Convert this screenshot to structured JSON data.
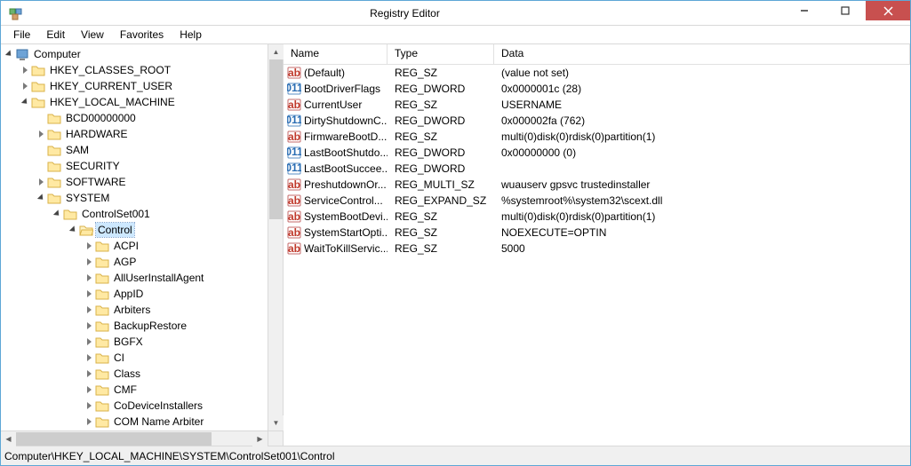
{
  "window": {
    "title": "Registry Editor"
  },
  "menu": {
    "file": "File",
    "edit": "Edit",
    "view": "View",
    "favorites": "Favorites",
    "help": "Help"
  },
  "tree": {
    "root": "Computer",
    "hives": {
      "hkcr": "HKEY_CLASSES_ROOT",
      "hkcu": "HKEY_CURRENT_USER",
      "hklm": "HKEY_LOCAL_MACHINE",
      "hklm_children": {
        "bcd": "BCD00000000",
        "hardware": "HARDWARE",
        "sam": "SAM",
        "security": "SECURITY",
        "software": "SOFTWARE",
        "system": "SYSTEM",
        "system_children": {
          "cs001": "ControlSet001",
          "cs001_children": {
            "control": "Control",
            "control_children": [
              "ACPI",
              "AGP",
              "AllUserInstallAgent",
              "AppID",
              "Arbiters",
              "BackupRestore",
              "BGFX",
              "CI",
              "Class",
              "CMF",
              "CoDeviceInstallers",
              "COM Name Arbiter"
            ]
          }
        }
      }
    }
  },
  "list": {
    "headers": {
      "name": "Name",
      "type": "Type",
      "data": "Data"
    },
    "rows": [
      {
        "icon": "sz",
        "name": "(Default)",
        "type": "REG_SZ",
        "data": "(value not set)"
      },
      {
        "icon": "dw",
        "name": "BootDriverFlags",
        "type": "REG_DWORD",
        "data": "0x0000001c (28)"
      },
      {
        "icon": "sz",
        "name": "CurrentUser",
        "type": "REG_SZ",
        "data": "USERNAME"
      },
      {
        "icon": "dw",
        "name": "DirtyShutdownC...",
        "type": "REG_DWORD",
        "data": "0x000002fa (762)"
      },
      {
        "icon": "sz",
        "name": "FirmwareBootD...",
        "type": "REG_SZ",
        "data": "multi(0)disk(0)rdisk(0)partition(1)"
      },
      {
        "icon": "dw",
        "name": "LastBootShutdo...",
        "type": "REG_DWORD",
        "data": "0x00000000 (0)"
      },
      {
        "icon": "dw",
        "name": "LastBootSuccee...",
        "type": "REG_DWORD",
        "data": ""
      },
      {
        "icon": "sz",
        "name": "PreshutdownOr...",
        "type": "REG_MULTI_SZ",
        "data": "wuauserv gpsvc trustedinstaller"
      },
      {
        "icon": "sz",
        "name": "ServiceControl...",
        "type": "REG_EXPAND_SZ",
        "data": "%systemroot%\\system32\\scext.dll"
      },
      {
        "icon": "sz",
        "name": "SystemBootDevi...",
        "type": "REG_SZ",
        "data": "multi(0)disk(0)rdisk(0)partition(1)"
      },
      {
        "icon": "sz",
        "name": "SystemStartOpti...",
        "type": "REG_SZ",
        "data": " NOEXECUTE=OPTIN"
      },
      {
        "icon": "sz",
        "name": "WaitToKillServic...",
        "type": "REG_SZ",
        "data": "5000"
      }
    ]
  },
  "status": {
    "path": "Computer\\HKEY_LOCAL_MACHINE\\SYSTEM\\ControlSet001\\Control"
  }
}
